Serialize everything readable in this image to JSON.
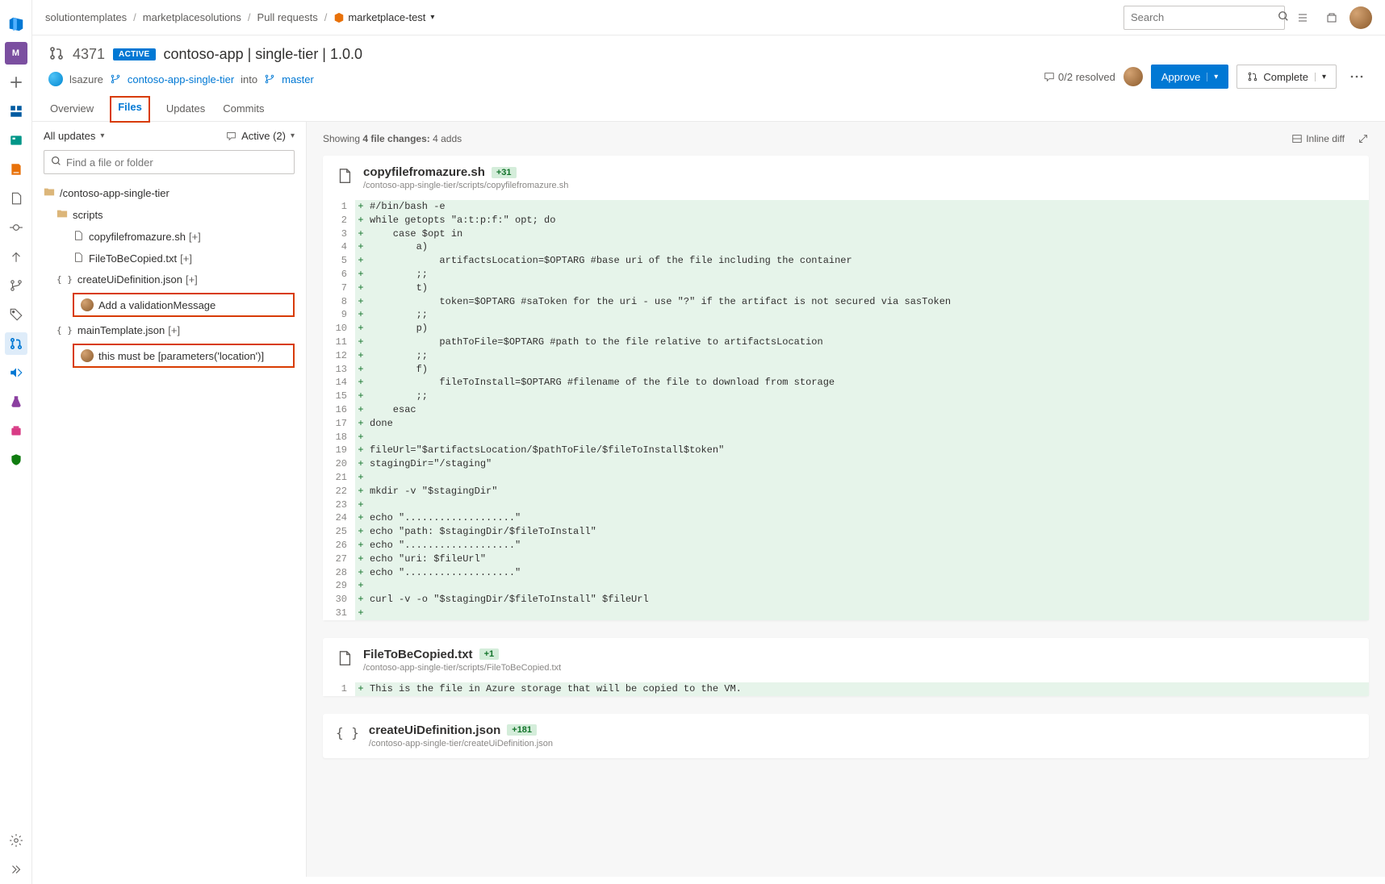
{
  "breadcrumb": {
    "org": "solutiontemplates",
    "project": "marketplacesolutions",
    "section": "Pull requests",
    "repo": "marketplace-test"
  },
  "search": {
    "placeholder": "Search"
  },
  "pr": {
    "id": "4371",
    "badge": "ACTIVE",
    "title": "contoso-app | single-tier | 1.0.0",
    "author": "lsazure",
    "source_branch": "contoso-app-single-tier",
    "into": "into",
    "target_branch": "master"
  },
  "actions": {
    "resolved": "0/2 resolved",
    "approve": "Approve",
    "complete": "Complete"
  },
  "tabs": {
    "overview": "Overview",
    "files": "Files",
    "updates": "Updates",
    "commits": "Commits"
  },
  "sidebar": {
    "all_updates": "All updates",
    "active_count": "Active (2)",
    "find_placeholder": "Find a file or folder",
    "root": "/contoso-app-single-tier",
    "scripts": "scripts",
    "files": [
      {
        "name": "copyfilefromazure.sh",
        "badge": "[+]"
      },
      {
        "name": "FileToBeCopied.txt",
        "badge": "[+]"
      },
      {
        "name": "createUiDefinition.json",
        "badge": "[+]"
      },
      {
        "name": "mainTemplate.json",
        "badge": "[+]"
      }
    ],
    "comments": [
      "Add a validationMessage",
      "this must be [parameters('location')]"
    ]
  },
  "diff_summary": {
    "showing": "Showing",
    "file_changes": "4 file changes:",
    "adds": "4 adds",
    "inline": "Inline diff"
  },
  "file1": {
    "name": "copyfilefromazure.sh",
    "badge": "+31",
    "path": "/contoso-app-single-tier/scripts/copyfilefromazure.sh",
    "lines": [
      "#/bin/bash -e",
      "while getopts \"a:t:p:f:\" opt; do",
      "    case $opt in",
      "        a)",
      "            artifactsLocation=$OPTARG #base uri of the file including the container",
      "        ;;",
      "        t)",
      "            token=$OPTARG #saToken for the uri - use \"?\" if the artifact is not secured via sasToken",
      "        ;;",
      "        p)",
      "            pathToFile=$OPTARG #path to the file relative to artifactsLocation",
      "        ;;",
      "        f)",
      "            fileToInstall=$OPTARG #filename of the file to download from storage",
      "        ;;",
      "    esac",
      "done",
      "",
      "fileUrl=\"$artifactsLocation/$pathToFile/$fileToInstall$token\"",
      "stagingDir=\"/staging\"",
      "",
      "mkdir -v \"$stagingDir\"",
      "",
      "echo \"...................\"",
      "echo \"path: $stagingDir/$fileToInstall\"",
      "echo \"...................\"",
      "echo \"uri: $fileUrl\"",
      "echo \"...................\"",
      "",
      "curl -v -o \"$stagingDir/$fileToInstall\" $fileUrl",
      ""
    ]
  },
  "file2": {
    "name": "FileToBeCopied.txt",
    "badge": "+1",
    "path": "/contoso-app-single-tier/scripts/FileToBeCopied.txt",
    "lines": [
      "This is the file in Azure storage that will be copied to the VM."
    ]
  },
  "file3": {
    "name": "createUiDefinition.json",
    "badge": "+181",
    "path": "/contoso-app-single-tier/createUiDefinition.json"
  }
}
